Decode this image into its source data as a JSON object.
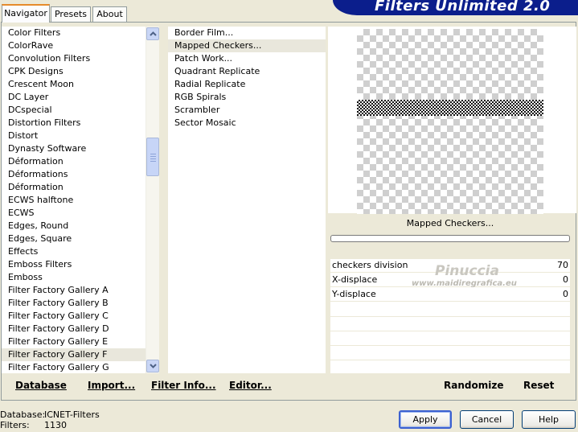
{
  "window": {
    "title": "Filters Unlimited 2.0"
  },
  "tabs": [
    {
      "label": "Navigator",
      "active": true
    },
    {
      "label": "Presets",
      "active": false
    },
    {
      "label": "About",
      "active": false
    }
  ],
  "categories": {
    "items": [
      "Color Filters",
      "ColorRave",
      "Convolution Filters",
      "CPK Designs",
      "Crescent Moon",
      "DC Layer",
      "DCspecial",
      "Distortion Filters",
      "Distort",
      "Dynasty Software",
      "Déformation",
      "Déformations",
      "Déformation",
      "ECWS halftone",
      "ECWS",
      "Edges, Round",
      "Edges, Square",
      "Effects",
      "Emboss Filters",
      "Emboss",
      "Filter Factory Gallery A",
      "Filter Factory Gallery B",
      "Filter Factory Gallery C",
      "Filter Factory Gallery D",
      "Filter Factory Gallery E",
      "Filter Factory Gallery F",
      "Filter Factory Gallery G"
    ],
    "selected_index": 25
  },
  "filters": {
    "items": [
      "Border Film...",
      "Mapped Checkers...",
      "Patch Work...",
      "Quadrant Replicate",
      "Radial Replicate",
      "RGB Spirals",
      "Scrambler",
      "Sector Mosaic"
    ],
    "selected_index": 1
  },
  "preview": {
    "filter_name": "Mapped Checkers...",
    "progress_percent": 0
  },
  "parameters": [
    {
      "label": "checkers division",
      "value": "70"
    },
    {
      "label": "X-displace",
      "value": "0"
    },
    {
      "label": "Y-displace",
      "value": "0"
    }
  ],
  "watermark": {
    "name": "Pinuccia",
    "site": "www.maidiregrafica.eu"
  },
  "toolbar": {
    "database": "Database",
    "import": "Import...",
    "filter_info": "Filter Info...",
    "editor": "Editor...",
    "randomize": "Randomize",
    "reset": "Reset"
  },
  "status": {
    "database_label": "Database:",
    "database_value": "ICNET-Filters",
    "filters_label": "Filters:",
    "filters_value": "1130"
  },
  "buttons": {
    "apply": "Apply",
    "cancel": "Cancel",
    "help": "Help"
  },
  "colors": {
    "banner": "#0b1e8c",
    "tab_accent": "#e68b2c",
    "selection": "#e9e7dc",
    "face": "#ece9d8"
  },
  "icons": {
    "scroll_up": "chevron-up-icon",
    "scroll_down": "chevron-down-icon"
  }
}
